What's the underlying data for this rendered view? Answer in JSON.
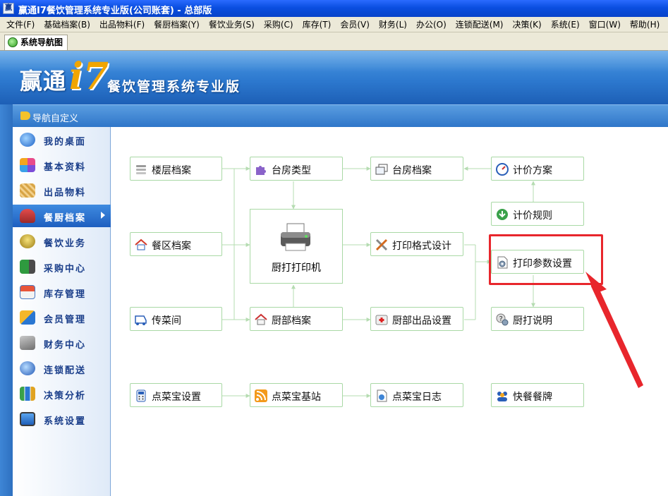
{
  "window": {
    "title": "赢通I7餐饮管理系统专业版(公司账套) - 总部版"
  },
  "menubar": [
    "文件(F)",
    "基础档案(B)",
    "出品物料(F)",
    "餐厨档案(Y)",
    "餐饮业务(S)",
    "采购(C)",
    "库存(T)",
    "会员(V)",
    "财务(L)",
    "办公(O)",
    "连锁配送(M)",
    "决策(K)",
    "系统(E)",
    "窗口(W)",
    "帮助(H)"
  ],
  "tab": {
    "label": "系统导航图"
  },
  "banner": {
    "brand": "赢通",
    "brand_i7": "i7",
    "subtitle": "餐饮管理系统专业版"
  },
  "nav_header": {
    "label": "导航自定义"
  },
  "sidebar": {
    "items": [
      {
        "label": "我的桌面",
        "icon": "globe-icon"
      },
      {
        "label": "基本资料",
        "icon": "puzzle-icon"
      },
      {
        "label": "出品物料",
        "icon": "basket-icon"
      },
      {
        "label": "餐厨档案",
        "icon": "chef-icon",
        "active": true
      },
      {
        "label": "餐饮业务",
        "icon": "dish-icon"
      },
      {
        "label": "采购中心",
        "icon": "truck-icon"
      },
      {
        "label": "库存管理",
        "icon": "house-icon"
      },
      {
        "label": "会员管理",
        "icon": "members-icon"
      },
      {
        "label": "财务中心",
        "icon": "finance-icon"
      },
      {
        "label": "连锁配送",
        "icon": "network-icon"
      },
      {
        "label": "决策分析",
        "icon": "chart-icon"
      },
      {
        "label": "系统设置",
        "icon": "monitor-icon"
      }
    ]
  },
  "flow": {
    "floor": "楼层档案",
    "room_type": "台房类型",
    "room_archive": "台房档案",
    "pricing_plan": "计价方案",
    "pricing_rule": "计价规则",
    "area": "餐区档案",
    "kitchen_printer": "厨打打印机",
    "print_format": "打印格式设计",
    "print_params": "打印参数设置",
    "serving": "传菜间",
    "kitchen_dept": "厨部档案",
    "kitchen_output": "厨部出品设置",
    "kitchen_help": "厨打说明",
    "dcb_settings": "点菜宝设置",
    "dcb_station": "点菜宝基站",
    "dcb_log": "点菜宝日志",
    "fast_food": "快餐餐牌"
  },
  "colors": {
    "titlebar": "#0a4ee0",
    "menubar": "#ece9d8",
    "banner": "#2d79cf",
    "brand_i7": "#f1a500",
    "node_border": "#a9d9a5",
    "highlight": "#e8262c"
  }
}
